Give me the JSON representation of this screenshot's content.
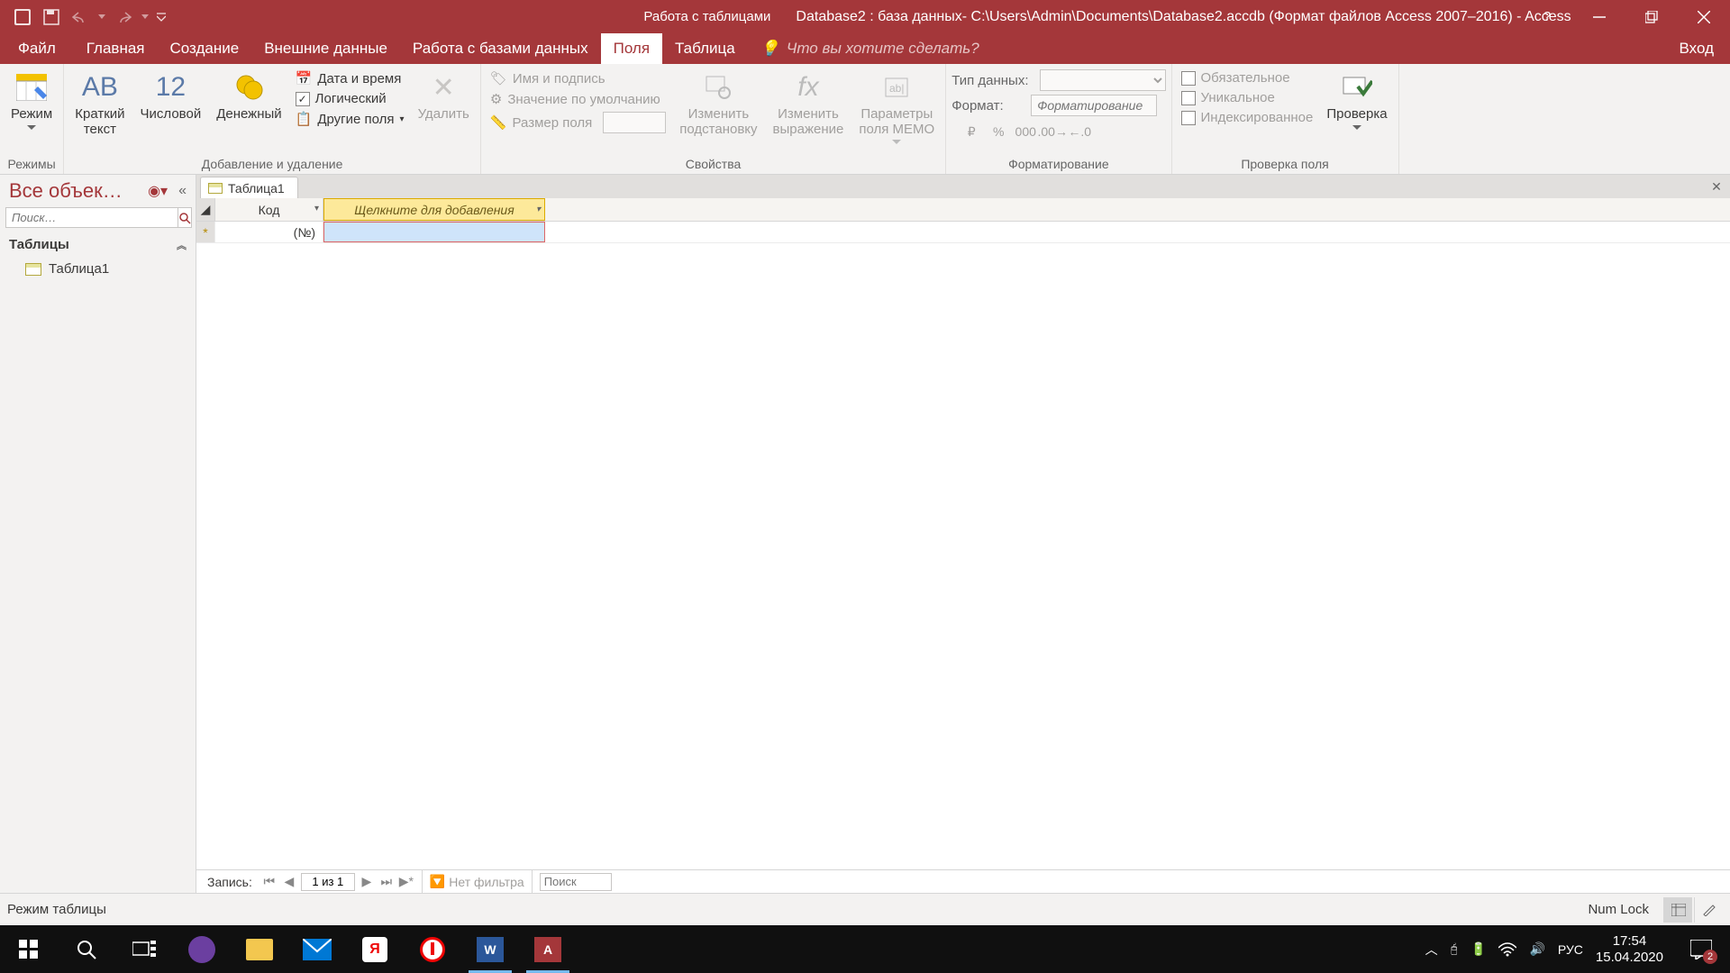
{
  "titlebar": {
    "context_label": "Работа с таблицами",
    "title": "Database2 : база данных- C:\\Users\\Admin\\Documents\\Database2.accdb (Формат файлов Access 2007–2016) - Access"
  },
  "tabs": {
    "file": "Файл",
    "items": [
      "Главная",
      "Создание",
      "Внешние данные",
      "Работа с базами данных"
    ],
    "context_items": [
      "Поля",
      "Таблица"
    ],
    "active": "Поля",
    "tell_me": "Что вы хотите сделать?",
    "login": "Вход"
  },
  "ribbon": {
    "groups": {
      "modes": {
        "label": "Режимы",
        "btn": "Режим"
      },
      "add_delete": {
        "label": "Добавление и удаление",
        "short_text": {
          "big": "AB",
          "lbl": "Краткий\nтекст"
        },
        "number": {
          "big": "12",
          "lbl": "Числовой"
        },
        "currency": {
          "lbl": "Денежный"
        },
        "datetime": "Дата и время",
        "yesno": "Логический",
        "more": "Другие поля",
        "delete": "Удалить"
      },
      "properties": {
        "label": "Свойства",
        "name_caption": "Имя и подпись",
        "default": "Значение по умолчанию",
        "size": "Размер поля",
        "lookup": "Изменить\nподстановку",
        "expression": "Изменить\nвыражение",
        "memo": "Параметры\nполя MEMO"
      },
      "formatting": {
        "label": "Форматирование",
        "data_type": "Тип данных:",
        "format": "Формат:",
        "format_placeholder": "Форматирование"
      },
      "validation": {
        "label": "Проверка поля",
        "required": "Обязательное",
        "unique": "Уникальное",
        "indexed": "Индексированное",
        "btn": "Проверка"
      }
    }
  },
  "nav": {
    "title": "Все объек…",
    "search_placeholder": "Поиск…",
    "group": "Таблицы",
    "items": [
      "Таблица1"
    ]
  },
  "doc": {
    "tab": "Таблица1",
    "col_id": "Код",
    "col_add": "Щелкните для добавления",
    "row_new": "(№)"
  },
  "recnav": {
    "label": "Запись:",
    "pos": "1 из 1",
    "filter": "Нет фильтра",
    "search": "Поиск"
  },
  "status": {
    "mode": "Режим таблицы",
    "numlock": "Num Lock"
  },
  "tray": {
    "lang": "РУС",
    "time": "17:54",
    "date": "15.04.2020",
    "notif_count": "2"
  }
}
